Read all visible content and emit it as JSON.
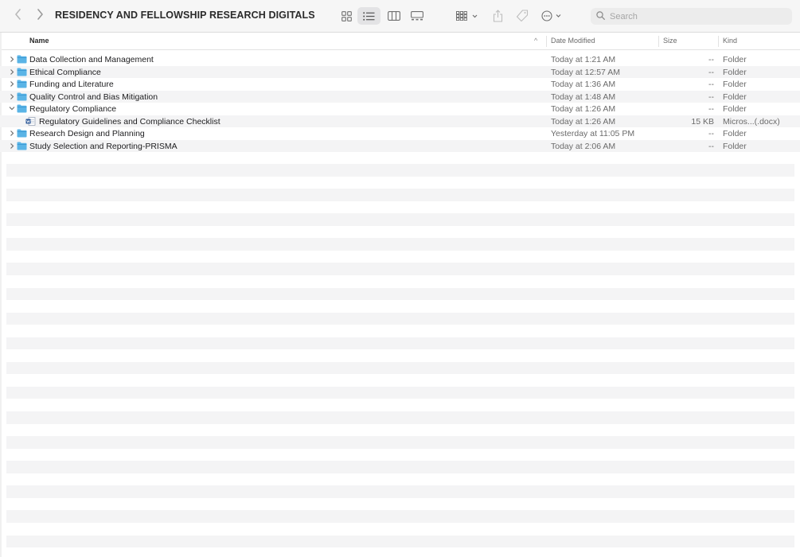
{
  "window": {
    "title": "RESIDENCY AND FELLOWSHIP RESEARCH DIGITALS",
    "view_mode": "list"
  },
  "toolbar": {
    "back_icon": "chevron-left-icon",
    "forward_icon": "chevron-right-icon",
    "view_icons": [
      "icon-view-icon",
      "list-view-icon",
      "column-view-icon",
      "gallery-view-icon"
    ],
    "group_icon": "group-by-icon",
    "share_icon": "share-icon",
    "tag_icon": "tag-icon",
    "more_icon": "more-actions-icon"
  },
  "search": {
    "placeholder": "Search"
  },
  "columns": {
    "name": "Name",
    "date_modified": "Date Modified",
    "size": "Size",
    "kind": "Kind"
  },
  "items": [
    {
      "name": "Data Collection and Management",
      "date": "Today at 1:21 AM",
      "size": "--",
      "kind": "Folder",
      "type": "folder",
      "expanded": false,
      "indent": 0
    },
    {
      "name": "Ethical Compliance",
      "date": "Today at 12:57 AM",
      "size": "--",
      "kind": "Folder",
      "type": "folder",
      "expanded": false,
      "indent": 0
    },
    {
      "name": "Funding and Literature",
      "date": "Today at 1:36 AM",
      "size": "--",
      "kind": "Folder",
      "type": "folder",
      "expanded": false,
      "indent": 0
    },
    {
      "name": "Quality Control and Bias Mitigation",
      "date": "Today at 1:48 AM",
      "size": "--",
      "kind": "Folder",
      "type": "folder",
      "expanded": false,
      "indent": 0
    },
    {
      "name": "Regulatory Compliance",
      "date": "Today at 1:26 AM",
      "size": "--",
      "kind": "Folder",
      "type": "folder",
      "expanded": true,
      "indent": 0
    },
    {
      "name": "Regulatory Guidelines and Compliance Checklist",
      "date": "Today at 1:26 AM",
      "size": "15 KB",
      "kind": "Micros...(.docx)",
      "type": "document",
      "expanded": false,
      "indent": 1
    },
    {
      "name": "Research Design and Planning",
      "date": "Yesterday at 11:05 PM",
      "size": "--",
      "kind": "Folder",
      "type": "folder",
      "expanded": false,
      "indent": 0
    },
    {
      "name": "Study Selection and Reporting-PRISMA",
      "date": "Today at 2:06 AM",
      "size": "--",
      "kind": "Folder",
      "type": "folder",
      "expanded": false,
      "indent": 0
    }
  ],
  "colors": {
    "folder": "#5ab4e6",
    "folder_dark": "#3d9bd6",
    "doc_blue": "#2b5797",
    "stripe": "#f4f4f5"
  }
}
